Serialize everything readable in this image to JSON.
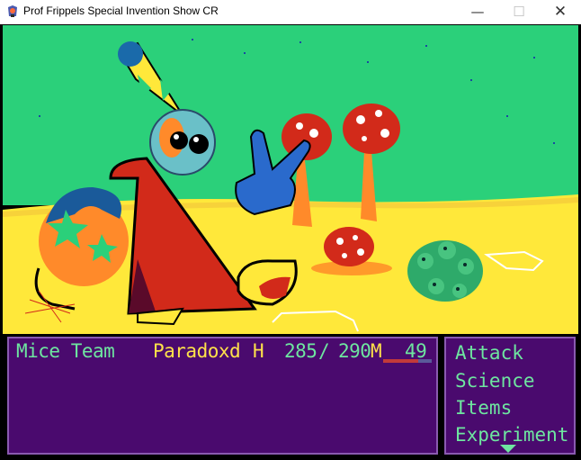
{
  "window": {
    "title": "Prof Frippels Special Invention Show CR",
    "minimize_glyph": "—",
    "maximize_glyph": "☐",
    "close_glyph": "✕"
  },
  "scene": {
    "sky_color": "#2bd07a",
    "ground_color": "#ffe83a",
    "description_icons": [
      "wizard-character",
      "orb-sack",
      "pointing-glove",
      "mushroom",
      "shoe",
      "green-critters"
    ]
  },
  "status": {
    "party_label": "Mice Team",
    "character_name": "Paradoxd",
    "hp_label": "H",
    "hp_current": "285",
    "hp_separator": "/",
    "hp_max": "290",
    "mp_label": "M",
    "mp_value": "49",
    "mp_fraction": 0.72
  },
  "commands": [
    "Attack",
    "Science",
    "Items",
    "Experiment"
  ],
  "colors": {
    "panel": "#4a0a6e",
    "panel_border": "#8a5ab0",
    "text_green": "#6ee6a0",
    "text_yellow": "#ffe24a"
  }
}
